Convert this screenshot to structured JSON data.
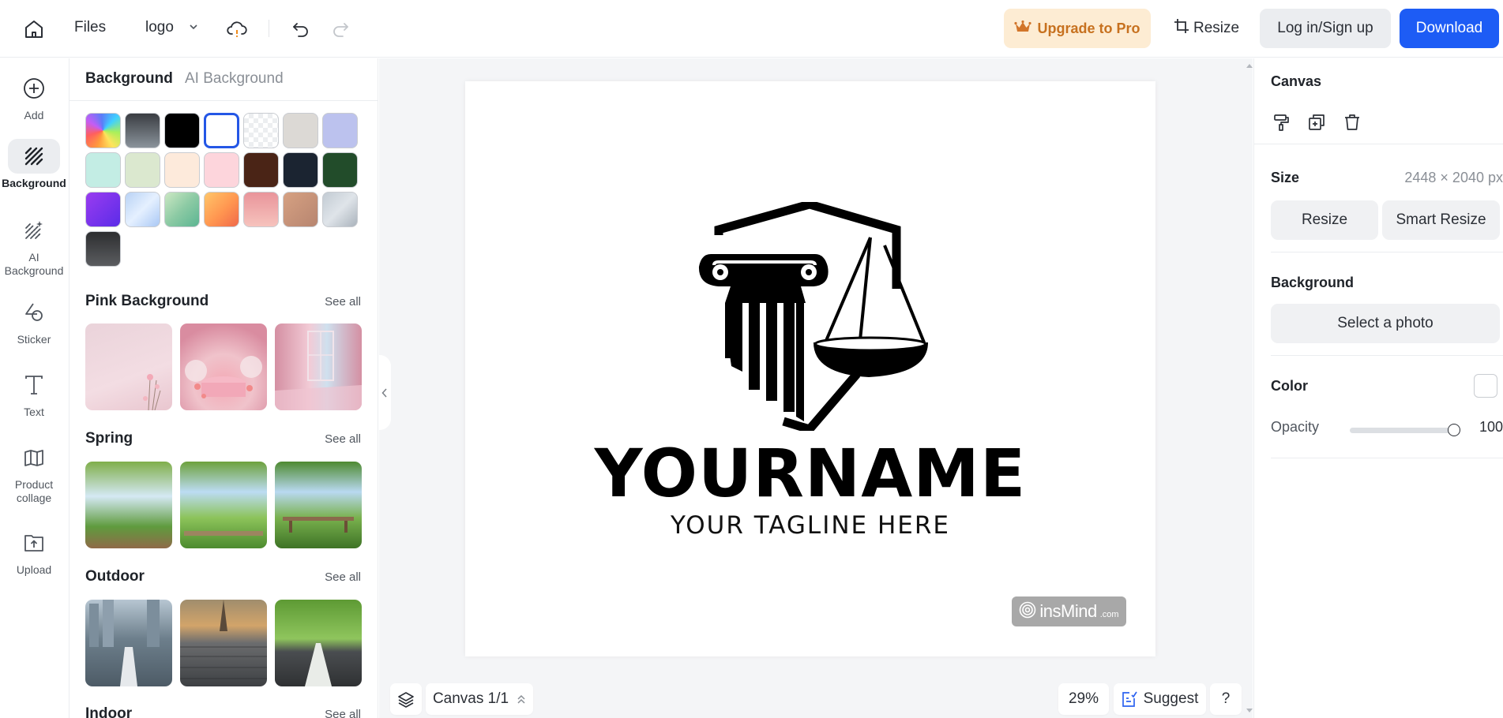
{
  "topbar": {
    "files_label": "Files",
    "project_name": "logo",
    "upgrade_label": "Upgrade to Pro",
    "resize_label": "Resize",
    "login_label": "Log in/Sign up",
    "download_label": "Download",
    "icons": [
      "home-icon",
      "chevron-down-icon",
      "cloud-sync-warning-icon",
      "undo-icon",
      "redo-icon",
      "crown-icon",
      "crop-icon"
    ]
  },
  "rail": {
    "items": [
      {
        "label": "Add",
        "icon": "plus-circle-icon",
        "active": false
      },
      {
        "label": "Background",
        "icon": "background-hatch-icon",
        "active": true
      },
      {
        "label": "AI Background",
        "icon": "ai-background-icon",
        "active": false
      },
      {
        "label": "Sticker",
        "icon": "sticker-shapes-icon",
        "active": false
      },
      {
        "label": "Text",
        "icon": "text-t-icon",
        "active": false
      },
      {
        "label": "Product collage",
        "icon": "collage-icon",
        "active": false
      },
      {
        "label": "Upload",
        "icon": "upload-folder-icon",
        "active": false
      }
    ]
  },
  "panel": {
    "tabs": [
      {
        "label": "Background",
        "active": true
      },
      {
        "label": "AI Background",
        "active": false
      }
    ],
    "swatches": [
      {
        "name": "rainbow-gradient",
        "fill": "conic-gradient(from 200deg, #ff9a3c, #ff5e5e, #c45df5, #5b7cf8, #40d0ff, #a8f05a, #ffe45c, #ff9a3c)"
      },
      {
        "name": "dark-gray-gradient",
        "fill": "linear-gradient(180deg, #3a3d42, #8a939b)"
      },
      {
        "name": "black",
        "fill": "#000000"
      },
      {
        "name": "white",
        "fill": "#ffffff",
        "selected": true
      },
      {
        "name": "transparent",
        "fill": "repeating-conic-gradient(#eceef0 0% 25%, #ffffff 0% 50%) 0 0/12px 12px"
      },
      {
        "name": "light-gray",
        "fill": "#dcd9d5"
      },
      {
        "name": "lavender",
        "fill": "#bcc2ee"
      },
      {
        "name": "mint",
        "fill": "#c3ede4"
      },
      {
        "name": "sage",
        "fill": "#dbe8cf"
      },
      {
        "name": "cream",
        "fill": "#fdeadb"
      },
      {
        "name": "pink",
        "fill": "#fdd5dc"
      },
      {
        "name": "brown",
        "fill": "#4a2416"
      },
      {
        "name": "navy",
        "fill": "#1b2431"
      },
      {
        "name": "forest-green",
        "fill": "#224c2a"
      },
      {
        "name": "purple-gradient",
        "fill": "linear-gradient(135deg, #9a3cf0, #5b2ce8)"
      },
      {
        "name": "sky-gradient",
        "fill": "linear-gradient(135deg, #b8d2f5, #e5f0ff 50%, #a9c8f5)"
      },
      {
        "name": "green-gradient",
        "fill": "linear-gradient(135deg, #cce8c3, #8ccaa4 50%, #5bb592)"
      },
      {
        "name": "orange-gradient",
        "fill": "linear-gradient(135deg, #ffc66a, #ff9550 55%, #f0694a)"
      },
      {
        "name": "rose-gradient",
        "fill": "linear-gradient(180deg, #e9949a, #f6c3bd)"
      },
      {
        "name": "copper-gradient",
        "fill": "linear-gradient(135deg, #d6a182, #b78570)"
      },
      {
        "name": "silver-gradient",
        "fill": "linear-gradient(135deg, #c2cbd3, #dfe4e9 50%, #aab3bc)"
      },
      {
        "name": "charcoal-gradient",
        "fill": "linear-gradient(180deg, #2d2e30, #5b5d60)"
      }
    ],
    "sections": [
      {
        "title": "Pink Background",
        "see_all": "See all",
        "thumbs": [
          {
            "name": "pink-wall-flowers",
            "fill": "linear-gradient(160deg, #ead3da, #f3dde3 60%, #e9c6cf)"
          },
          {
            "name": "pink-podium-roses",
            "fill": "radial-gradient(circle at 50% 70%, #f3a9b5, #f0c3cb 40%, #d98ca0 80%)"
          },
          {
            "name": "pink-window-room",
            "fill": "linear-gradient(90deg, #d48fa2, #f2cbd6 40%, #cfe0ee 60%, #d48fa2)"
          }
        ]
      },
      {
        "title": "Spring",
        "see_all": "See all",
        "thumbs": [
          {
            "name": "spring-table-bokeh",
            "fill": "linear-gradient(180deg, #7fae4a, #d5e9f4 40%, #5f9b3e 75%, #8f6a48)"
          },
          {
            "name": "spring-meadow-deck",
            "fill": "linear-gradient(180deg, #6da13c, #bcdcf3 35%, #8cc35a 65%, #4c8b2e)"
          },
          {
            "name": "spring-bench",
            "fill": "linear-gradient(180deg, #4e8a30, #b9d9f1 35%, #79b14d 65%, #3e7326)"
          }
        ]
      },
      {
        "title": "Outdoor",
        "see_all": "See all",
        "thumbs": [
          {
            "name": "outdoor-city-road",
            "fill": "linear-gradient(180deg, #b7c6d2, #6d7f8c 45%, #4d5b66)"
          },
          {
            "name": "outdoor-paris-cobblestone",
            "fill": "linear-gradient(180deg, #a08d6d, #d2a46a 30%, #6b6c6e 50%, #3d4043)"
          },
          {
            "name": "outdoor-park-road",
            "fill": "linear-gradient(180deg, #5d9a34, #8fc55d 45%, #4a4d50 60%, #2f3133)"
          }
        ]
      },
      {
        "title": "Indoor",
        "see_all": "See all",
        "thumbs": []
      }
    ]
  },
  "canvas": {
    "logo_name": "YOURNAME",
    "logo_tagline": "YOUR TAGLINE HERE",
    "watermark_brand": "insMind",
    "watermark_domain": ".com"
  },
  "workspace": {
    "page_indicator": "Canvas 1/1",
    "zoom": "29%",
    "suggest_label": "Suggest",
    "help_label": "?"
  },
  "right_panel": {
    "canvas_title": "Canvas",
    "size_title": "Size",
    "size_value": "2448 × 2040 px",
    "resize_label": "Resize",
    "smart_resize_label": "Smart Resize",
    "background_title": "Background",
    "select_photo_label": "Select a photo",
    "color_title": "Color",
    "color_value": "#ffffff",
    "opacity_label": "Opacity",
    "opacity_value": "100",
    "opacity_fraction": 1.0
  }
}
